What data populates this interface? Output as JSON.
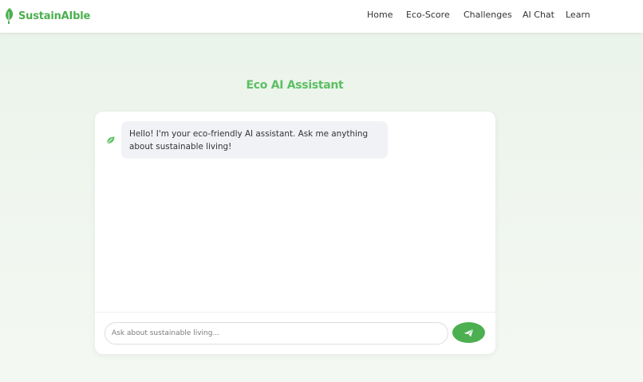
{
  "brand": {
    "name": "SustainAIble",
    "icon": "leaf-icon",
    "color": "#4caf50"
  },
  "nav": {
    "items": [
      {
        "label": "Home"
      },
      {
        "label": "Eco-Score"
      },
      {
        "label": "Challenges"
      },
      {
        "label": "AI Chat"
      },
      {
        "label": "Learn"
      }
    ]
  },
  "main": {
    "title": "Eco AI Assistant",
    "title_color": "#5cbf63"
  },
  "chat": {
    "messages": [
      {
        "sender": "bot",
        "avatar_icon": "leaf-icon",
        "text": "Hello! I'm your eco-friendly AI assistant. Ask me anything about sustainable living!"
      }
    ],
    "input": {
      "placeholder": "Ask about sustainable living...",
      "value": ""
    },
    "send": {
      "icon": "send-icon",
      "color": "#4caf50"
    }
  }
}
